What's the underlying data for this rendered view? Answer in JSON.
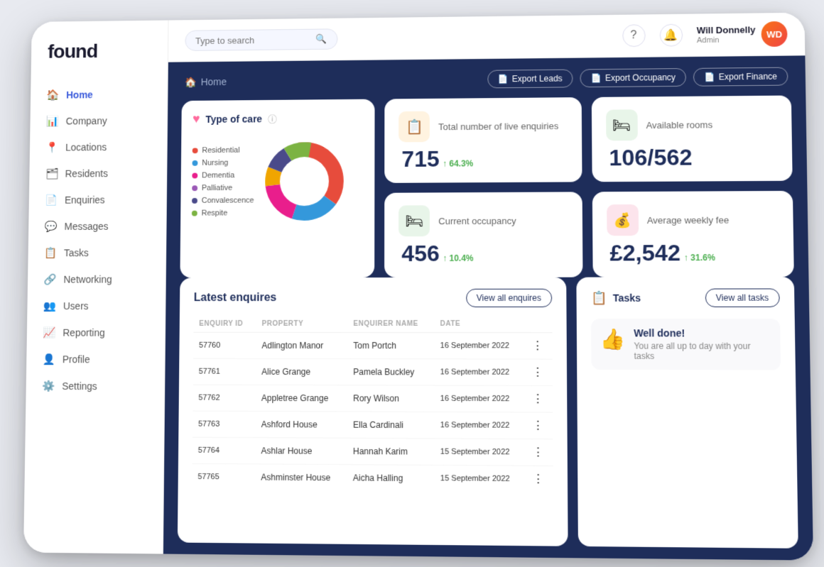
{
  "app": {
    "logo": "found",
    "search_placeholder": "Type to search"
  },
  "sidebar": {
    "items": [
      {
        "id": "home",
        "label": "Home",
        "icon": "🏠",
        "active": true
      },
      {
        "id": "company",
        "label": "Company",
        "icon": "📊"
      },
      {
        "id": "locations",
        "label": "Locations",
        "icon": "📍"
      },
      {
        "id": "residents",
        "label": "Residents",
        "icon": "🗂"
      },
      {
        "id": "enquiries",
        "label": "Enquiries",
        "icon": "📄"
      },
      {
        "id": "messages",
        "label": "Messages",
        "icon": "💬"
      },
      {
        "id": "tasks",
        "label": "Tasks",
        "icon": "📋"
      },
      {
        "id": "networking",
        "label": "Networking",
        "icon": "🔗"
      },
      {
        "id": "users",
        "label": "Users",
        "icon": "👥"
      },
      {
        "id": "reporting",
        "label": "Reporting",
        "icon": "📈"
      },
      {
        "id": "profile",
        "label": "Profile",
        "icon": "👤"
      },
      {
        "id": "settings",
        "label": "Settings",
        "icon": "⚙️"
      }
    ]
  },
  "topbar": {
    "breadcrumb": "Home",
    "home_icon": "🏠",
    "help_label": "?",
    "notification_icon": "🔔",
    "user": {
      "name": "Will Donnelly",
      "role": "Admin",
      "initials": "WD"
    }
  },
  "exports": {
    "export_leads": "Export Leads",
    "export_occupancy": "Export Occupancy",
    "export_finance": "Export Finance"
  },
  "stats": {
    "enquiries": {
      "label": "Total number of live enquiries",
      "value": "715",
      "change": "64.3%",
      "icon": "📋",
      "color": "orange"
    },
    "available_rooms": {
      "label": "Available rooms",
      "value": "106/562",
      "icon": "🛏",
      "color": "green"
    },
    "occupancy": {
      "label": "Current occupancy",
      "value": "456",
      "change": "10.4%",
      "icon": "🛏",
      "color": "green"
    },
    "weekly_fee": {
      "label": "Average weekly fee",
      "value": "£2,542",
      "change": "31.6%",
      "icon": "💰",
      "color": "red"
    }
  },
  "type_of_care": {
    "title": "Type of care",
    "legend": [
      {
        "label": "Residential",
        "color": "#e74c3c",
        "value": 35
      },
      {
        "label": "Nursing",
        "color": "#3498db",
        "value": 20
      },
      {
        "label": "Dementia",
        "color": "#e91e8c",
        "value": 18
      },
      {
        "label": "Palliative",
        "color": "#9b59b6",
        "value": 8
      },
      {
        "label": "Convalescence",
        "color": "#4a4a8a",
        "value": 10
      },
      {
        "label": "Respite",
        "color": "#7cb342",
        "value": 9
      }
    ]
  },
  "enquiries_table": {
    "title": "Latest enquires",
    "view_all_label": "View all enquires",
    "columns": [
      "Enquiry ID",
      "Property",
      "Enquirer Name",
      "Date"
    ],
    "rows": [
      {
        "id": "57760",
        "property": "Adlington Manor",
        "name": "Tom Portch",
        "date": "16 September 2022"
      },
      {
        "id": "57761",
        "property": "Alice Grange",
        "name": "Pamela Buckley",
        "date": "16 September 2022"
      },
      {
        "id": "57762",
        "property": "Appletree Grange",
        "name": "Rory Wilson",
        "date": "16 September 2022"
      },
      {
        "id": "57763",
        "property": "Ashford House",
        "name": "Ella Cardinali",
        "date": "16 September 2022"
      },
      {
        "id": "57764",
        "property": "Ashlar House",
        "name": "Hannah Karim",
        "date": "15 September 2022"
      },
      {
        "id": "57765",
        "property": "Ashminster House",
        "name": "Aicha Halling",
        "date": "15 September 2022"
      }
    ]
  },
  "tasks": {
    "title": "Tasks",
    "view_all_label": "View all tasks",
    "well_done_title": "Well done!",
    "well_done_message": "You are all up to day with your tasks"
  }
}
